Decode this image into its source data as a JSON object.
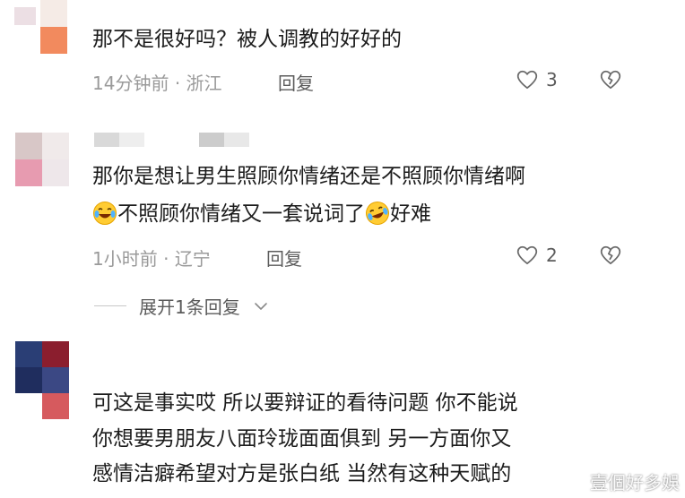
{
  "comments": [
    {
      "text": "那不是很好吗？被人调教的好好的",
      "time": "14分钟前",
      "separator": "·",
      "location": "浙江",
      "reply_label": "回复",
      "likes": "3",
      "avatar_colors": [
        "#e6d8de",
        "#f3f0f1",
        "#f5ebe6",
        "#f28a5e"
      ],
      "like_icon": "heart-outline-icon",
      "dislike_icon": "broken-heart-icon"
    },
    {
      "text_line1": "那你是想让男生照顾你情绪还是不照顾你情绪啊",
      "text_line2_a": "不照顾你情绪又一套说词了",
      "text_line2_b": "好难",
      "emoji": "laughing-crying-emoji",
      "time": "1小时前",
      "separator": "·",
      "location": "辽宁",
      "reply_label": "回复",
      "likes": "2",
      "avatar_colors": [
        "#d8c7c7",
        "#f0eaea",
        "#e79bb0",
        "#eee7ea"
      ],
      "name_colors": [
        "#d9d9d9",
        "#eeeeee",
        "#cccccc",
        "#e8e8e8"
      ]
    },
    {
      "text_line1": "可这是事实哎 所以要辩证的看待问题 你不能说",
      "text_line2": "你想要男朋友八面玲珑面面俱到 另一方面你又",
      "text_line3": "感情洁癖希望对方是张白纸 当然有这种天赋的",
      "avatar_colors": [
        "#2a3e75",
        "#8b1e2e",
        "#1f2d5e",
        "#3b4884",
        "#ffffff",
        "#d65a5e"
      ]
    }
  ],
  "expand_replies_label": "展开1条回复",
  "watermark": "壹個好多娛",
  "accent_red": "#e8454a"
}
